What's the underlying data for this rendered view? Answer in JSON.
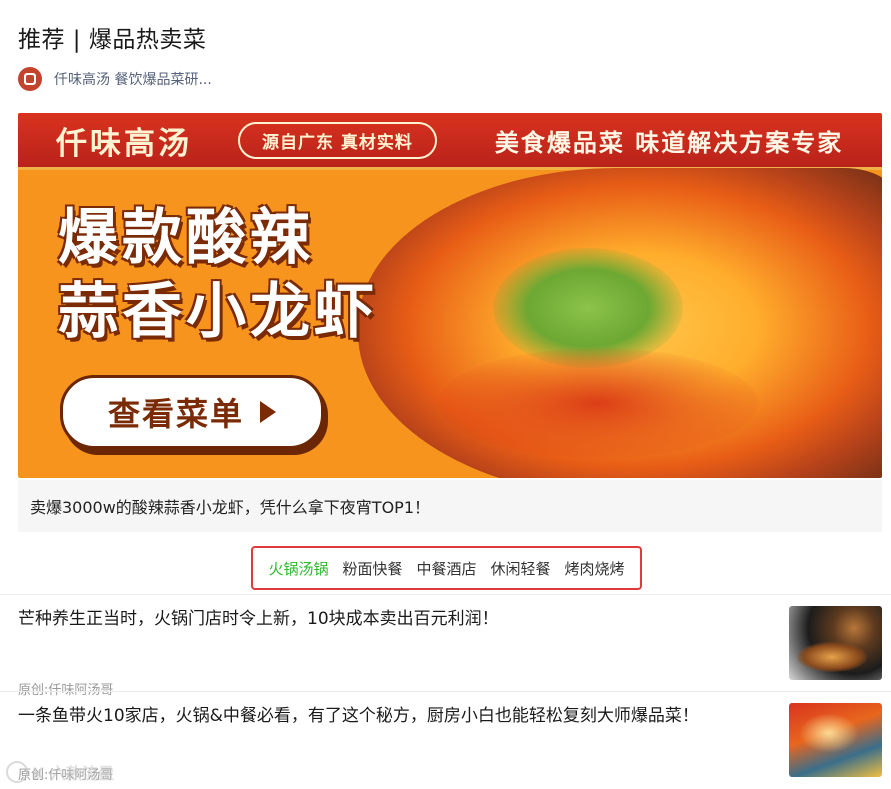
{
  "page": {
    "title": "推荐 | 爆品热卖菜"
  },
  "author": {
    "name": "仟味高汤 餐饮爆品菜研..."
  },
  "banner": {
    "brand": "仟味高汤",
    "pill": "源自广东 真材实料",
    "slogan": "美食爆品菜 味道解决方案专家",
    "headline_line1": "爆款酸辣",
    "headline_line2": "蒜香小龙虾",
    "cta_label": "查看菜单",
    "caption": "卖爆3000w的酸辣蒜香小龙虾，凭什么拿下夜宵TOP1！"
  },
  "tabs": [
    {
      "label": "火锅汤锅",
      "active": true
    },
    {
      "label": "粉面快餐",
      "active": false
    },
    {
      "label": "中餐酒店",
      "active": false
    },
    {
      "label": "休闲轻餐",
      "active": false
    },
    {
      "label": "烤肉烧烤",
      "active": false
    }
  ],
  "articles": [
    {
      "title": "芒种养生正当时，火锅门店时令上新，10块成本卖出百元利润！",
      "source": "原创:仟味阿汤哥"
    },
    {
      "title": "一条鱼带火10家店，火锅&中餐必看，有了这个秘方，厨房小白也能轻松复刻大师爆品菜！",
      "source": "原创:仟味阿汤哥"
    }
  ],
  "watermark": {
    "text": "K 六款流量"
  },
  "colors": {
    "brand_red": "#d9331f",
    "banner_orange": "#f7941d",
    "active_tab": "#2eb82e",
    "highlight_border": "#e23a3a"
  }
}
